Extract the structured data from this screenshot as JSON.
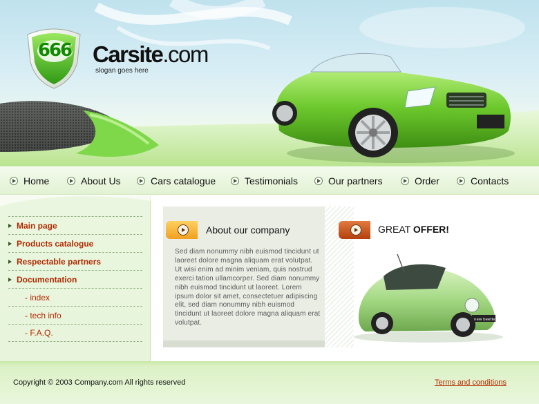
{
  "header": {
    "logo_number": "666",
    "site_name": "Carsite",
    "site_tld": ".com",
    "slogan": "slogan goes here"
  },
  "nav": [
    {
      "label": "Home"
    },
    {
      "label": "About Us"
    },
    {
      "label": "Cars catalogue"
    },
    {
      "label": "Testimonials"
    },
    {
      "label": "Our partners"
    },
    {
      "label": "Order"
    },
    {
      "label": "Contacts"
    }
  ],
  "sidebar": {
    "items": [
      {
        "label": "Main page"
      },
      {
        "label": "Products catalogue"
      },
      {
        "label": "Respectable partners"
      },
      {
        "label": "Documentation"
      }
    ],
    "sub_items": [
      {
        "label": "- index"
      },
      {
        "label": "- tech info"
      },
      {
        "label": "- F.A.Q."
      }
    ]
  },
  "about": {
    "title": "About our company",
    "text": "Sed diam nonummy nibh euismod tincidunt ut laoreet dolore magna aliquam erat volutpat. Ut wisi enim ad minim veniam, quis nostrud exerci tation ullamcorper. Sed diam nonummy nibh euismod tincidunt ut laoreet. Lorem ipsum dolor sit amet, consectetuer adipiscing elit, sed diam nonummy nibh euismod tincidunt ut laoreet dolore magna aliquam erat volutpat."
  },
  "offer": {
    "title_regular": "GREAT ",
    "title_bold": "OFFER!",
    "badge_text": "new beetle"
  },
  "footer": {
    "copyright": "Copyright © 2003 Company.com   All rights reserved",
    "terms": "Terms and conditions"
  },
  "colors": {
    "accent_green": "#7ed04a",
    "link_red": "#b22a00",
    "orange_icon": "#f0a020",
    "rust_icon": "#c2501a"
  }
}
